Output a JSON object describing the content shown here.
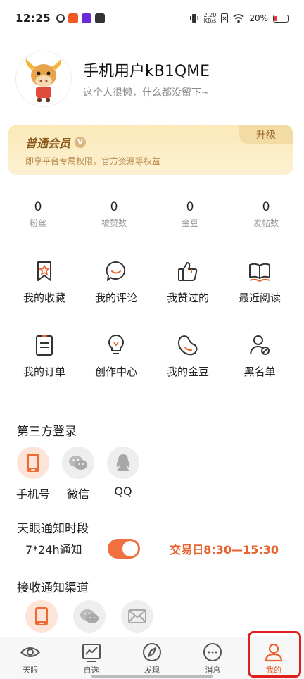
{
  "status": {
    "time": "12:25",
    "net_speed_top": "2.20",
    "net_speed_bottom": "KB/s",
    "battery": "20%"
  },
  "profile": {
    "username": "手机用户kB1QME",
    "bio": "这个人很懒，什么都没留下~"
  },
  "vip": {
    "title": "普通会员",
    "badge": "V",
    "description": "即享平台专属权限，官方资源等权益",
    "upgrade_label": "升级"
  },
  "stats": [
    {
      "value": "0",
      "label": "粉丝"
    },
    {
      "value": "0",
      "label": "被赞数"
    },
    {
      "value": "0",
      "label": "金豆"
    },
    {
      "value": "0",
      "label": "发帖数"
    }
  ],
  "grid": [
    {
      "label": "我的收藏",
      "icon": "bookmark-star-icon"
    },
    {
      "label": "我的评论",
      "icon": "comment-icon"
    },
    {
      "label": "我赞过的",
      "icon": "thumbs-up-icon"
    },
    {
      "label": "最近阅读",
      "icon": "book-icon"
    },
    {
      "label": "我的订单",
      "icon": "order-icon"
    },
    {
      "label": "创作中心",
      "icon": "lightbulb-icon"
    },
    {
      "label": "我的金豆",
      "icon": "bean-icon"
    },
    {
      "label": "黑名单",
      "icon": "blocked-user-icon"
    }
  ],
  "third_party": {
    "title": "第三方登录",
    "items": [
      {
        "label": "手机号",
        "icon": "phone-icon"
      },
      {
        "label": "微信",
        "icon": "wechat-icon"
      },
      {
        "label": "QQ",
        "icon": "qq-icon"
      }
    ]
  },
  "notify_time": {
    "title": "天眼通知时段",
    "mode": "7*24h通知",
    "trade_time": "交易日8:30—15:30",
    "enabled": true
  },
  "channel": {
    "title": "接收通知渠道"
  },
  "nav": [
    {
      "label": "天眼",
      "icon": "eye-icon"
    },
    {
      "label": "自选",
      "icon": "chart-icon"
    },
    {
      "label": "发现",
      "icon": "compass-icon"
    },
    {
      "label": "消息",
      "icon": "message-icon"
    },
    {
      "label": "我的",
      "icon": "user-icon"
    }
  ],
  "colors": {
    "accent": "#e8622c",
    "vip_bg": "#fbe9b8",
    "highlight": "#e0201c"
  }
}
